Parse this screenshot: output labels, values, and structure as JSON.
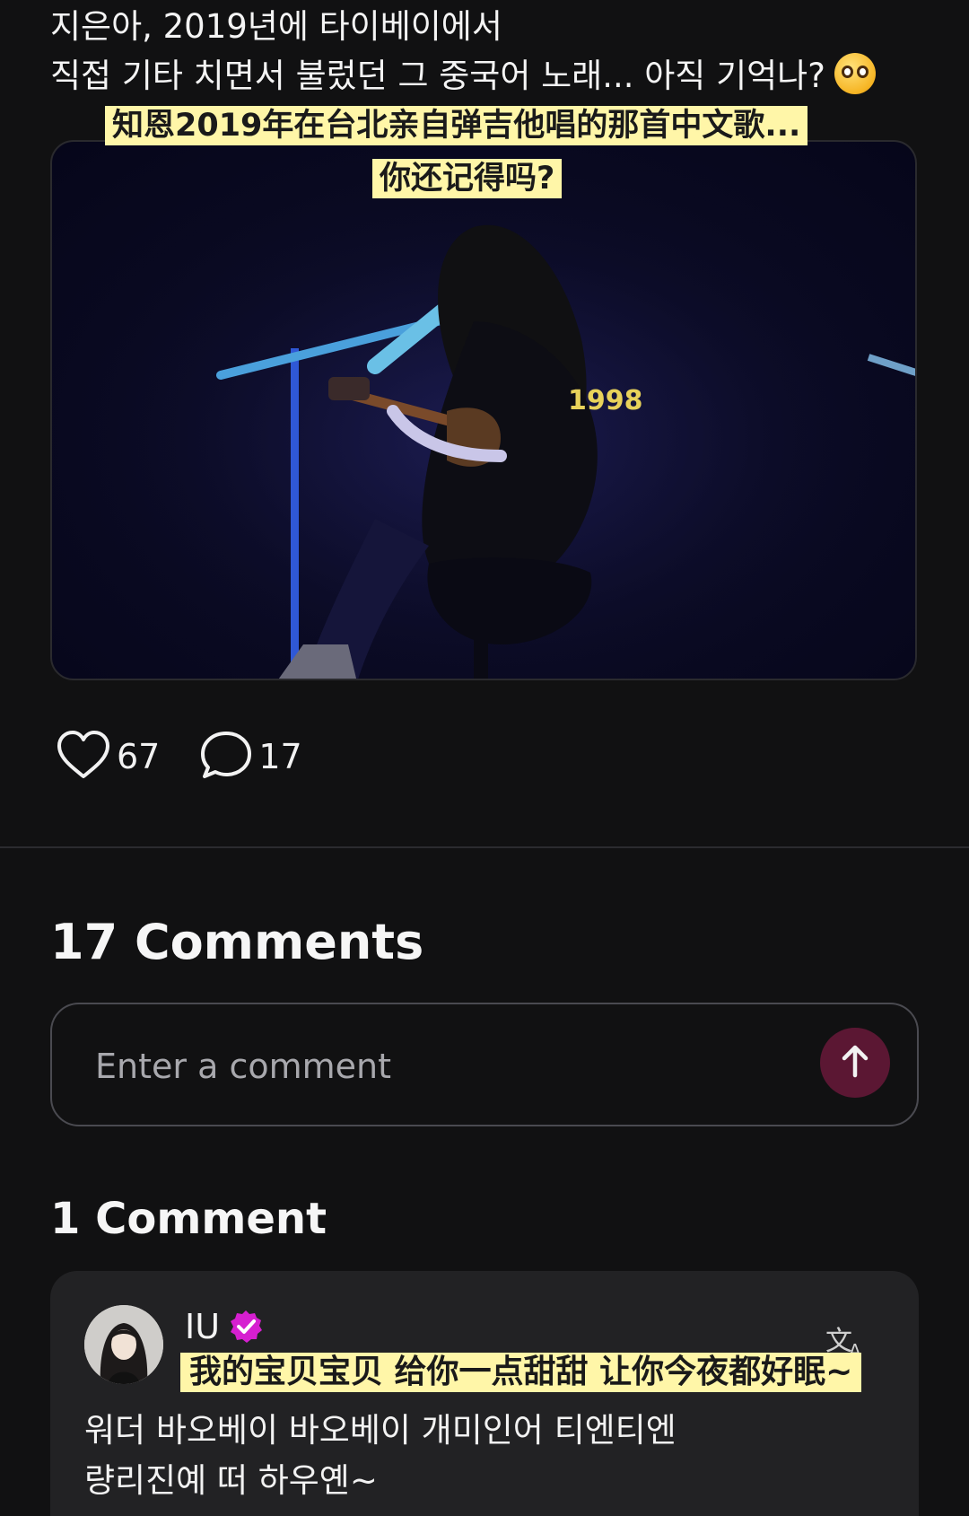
{
  "post": {
    "text_line1": "지은아, 2019년에 타이베이에서",
    "text_line2": "직접 기타 치면서 불렀던 그 중국어 노래... 아직 기억나?",
    "emoji_icon": "pleading-face-emoji",
    "caption_line1": "知恩2019年在台北亲自弹吉他唱的那首中文歌...",
    "caption_line2": "你还记得吗?",
    "likes": "67",
    "comments": "17"
  },
  "comments_section": {
    "heading": "17 Comments",
    "input_placeholder": "Enter a comment",
    "send_icon": "arrow-up-icon",
    "send_color": "#5b1733"
  },
  "thread": {
    "heading": "1 Comment",
    "items": [
      {
        "username": "IU",
        "verified_icon": "verified-badge-icon",
        "verified_color": "#d61fd0",
        "caption": "我的宝贝宝贝 给你一点甜甜 让你今夜都好眠~",
        "text_line1": "워더 바오베이 바오베이 개미인어 티엔티엔",
        "text_line2": "량리진예 떠 하우옌~",
        "translate_icon": "translate-icon"
      }
    ]
  },
  "colors": {
    "background": "#111112",
    "caption_highlight": "#fff6a8",
    "card": "#222224"
  }
}
